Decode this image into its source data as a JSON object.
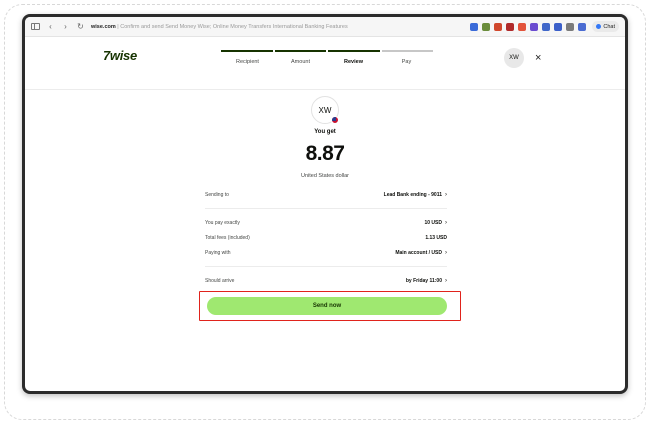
{
  "browser": {
    "url_domain": "wise.com",
    "url_rest": " | Confirm and send Send Money Wise; Online Money Transfers International Banking Features",
    "chat_label": "Chat",
    "extension_colors": [
      "#3a6ad8",
      "#6a8c3b",
      "#d0472c",
      "#b02a2a",
      "#e2533b",
      "#6a4bd0",
      "#4067c9",
      "#3b5fc9",
      "#7b7b7b",
      "#4a6bd1"
    ]
  },
  "header": {
    "logo": "7wise",
    "steps": [
      {
        "label": "Recipient",
        "done": true
      },
      {
        "label": "Amount",
        "done": true
      },
      {
        "label": "Review",
        "done": true,
        "active": true
      },
      {
        "label": "Pay",
        "done": false
      }
    ],
    "avatar_initials": "XW",
    "close_icon": "×"
  },
  "review": {
    "recipient_initials": "XW",
    "flag": "us-flag",
    "you_get_label": "You get",
    "amount": "8.87",
    "currency_name": "United States dollar",
    "sending_to_label": "Sending to",
    "sending_to_value": "Lead Bank ending - 9011",
    "you_pay_label": "You pay exactly",
    "you_pay_value": "10 USD",
    "fees_label": "Total fees (included)",
    "fees_value": "1.13 USD",
    "paying_with_label": "Paying with",
    "paying_with_value": "Main account / USD",
    "arrive_label": "Should arrive",
    "arrive_value": "by Friday 11:00",
    "send_button": "Send now"
  },
  "colors": {
    "accent_green": "#9fe870",
    "brand_dark": "#163300",
    "highlight_red": "#e0231c"
  }
}
